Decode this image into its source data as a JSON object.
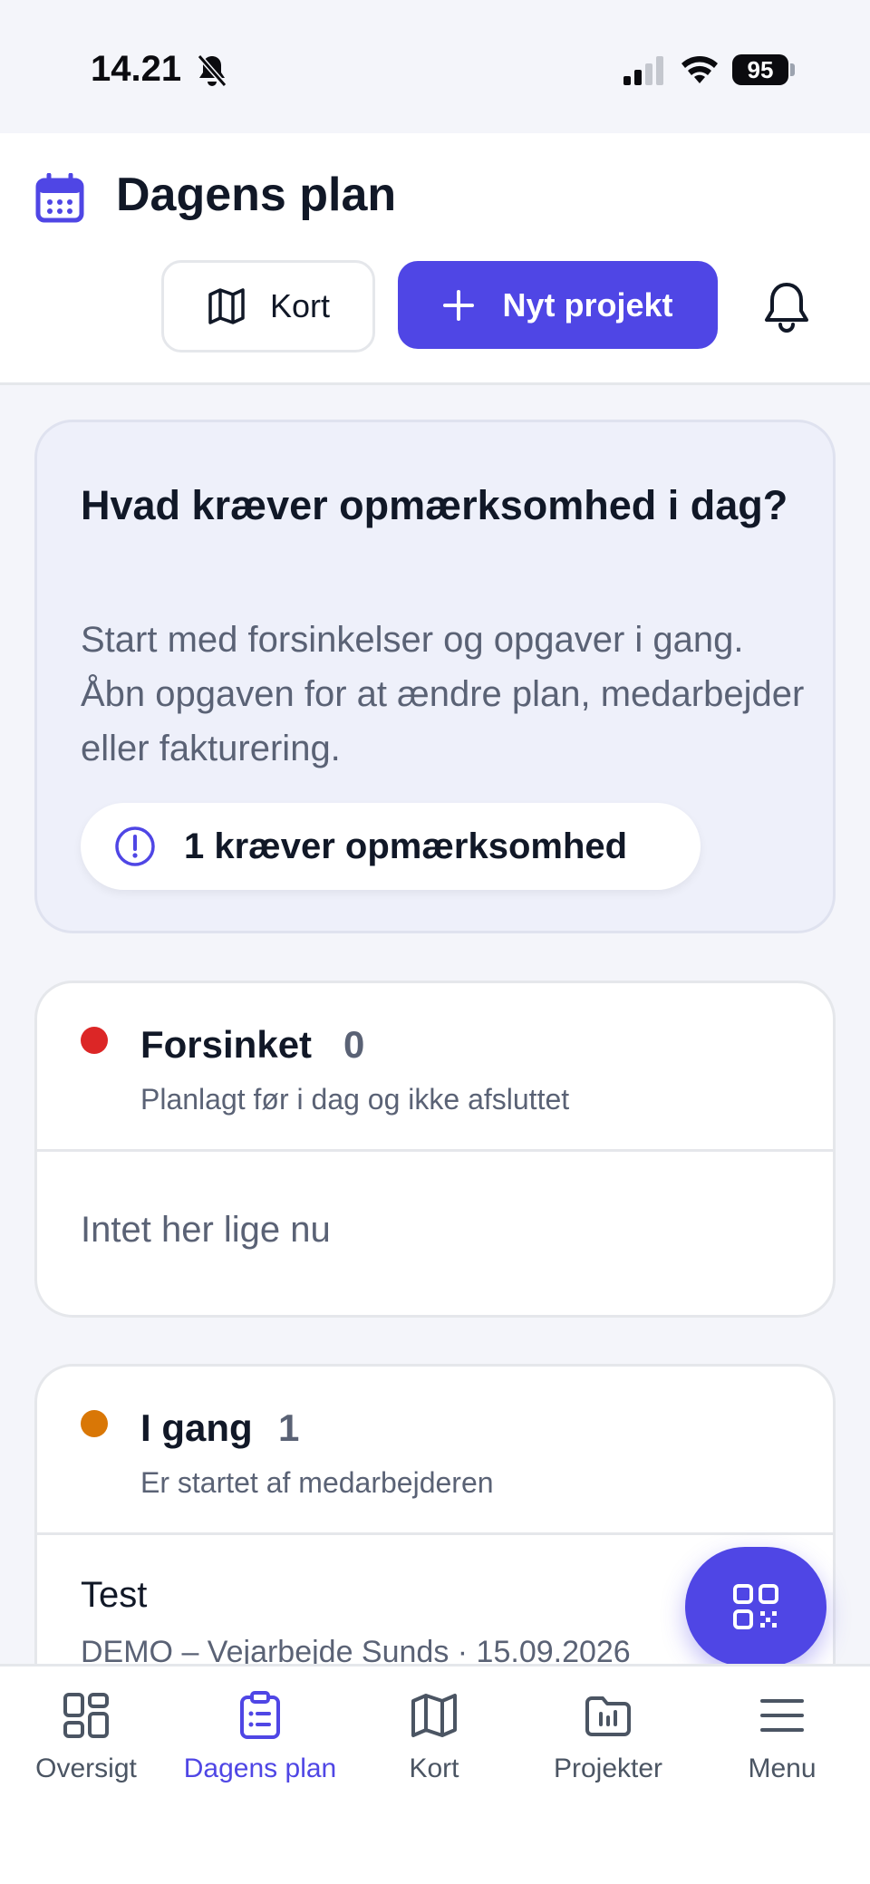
{
  "status_bar": {
    "time": "14.21",
    "battery": "95"
  },
  "header": {
    "title": "Dagens plan",
    "map_button": "Kort",
    "new_project_button": "Nyt projekt"
  },
  "focus_card": {
    "title": "Hvad kræver opmærksomhed i dag?",
    "description": "Start med forsinkelser og opgaver i gang. Åbn opgaven for at ændre plan, medarbejder eller fakturering.",
    "attention_label": "1 kræver opmærksomhed"
  },
  "sections": [
    {
      "title": "Forsinket",
      "count": "0",
      "subtitle": "Planlagt før i dag og ikke afsluttet",
      "empty_text": "Intet her lige nu",
      "dot_color": "#dc2626"
    },
    {
      "title": "I gang",
      "count": "1",
      "subtitle": "Er startet af medarbejderen",
      "dot_color": "#d97706",
      "items": [
        {
          "title": "Test",
          "meta": "DEMO – Vejarbejde Sunds · 15.09.2026"
        }
      ]
    }
  ],
  "tabbar": {
    "items": [
      {
        "label": "Oversigt",
        "icon": "grid-icon"
      },
      {
        "label": "Dagens plan",
        "icon": "clipboard-icon",
        "active": true
      },
      {
        "label": "Kort",
        "icon": "map-icon"
      },
      {
        "label": "Projekter",
        "icon": "folder-icon"
      },
      {
        "label": "Menu",
        "icon": "hamburger-icon"
      }
    ]
  },
  "colors": {
    "accent": "#4f46e5",
    "delayed": "#dc2626",
    "in_progress": "#d97706"
  }
}
